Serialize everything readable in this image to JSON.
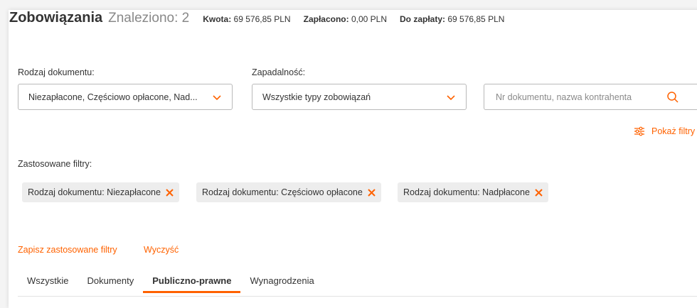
{
  "header": {
    "title": "Zobowiązania",
    "found": "Znaleziono: 2",
    "amount_label": "Kwota:",
    "amount_value": " 69 576,85 PLN",
    "paid_label": "Zapłacono:",
    "paid_value": " 0,00 PLN",
    "due_label": "Do zapłaty:",
    "due_value": " 69 576,85 PLN"
  },
  "filters": {
    "document_type_label": "Rodzaj dokumentu:",
    "document_type_value": "Niezapłacone, Częściowo opłacone, Nad...",
    "maturity_label": "Zapadalność:",
    "maturity_value": "Wszystkie typy zobowiązań",
    "search_placeholder": "Nr dokumentu, nazwa kontrahenta",
    "show_filters": "Pokaż filtry"
  },
  "applied": {
    "label": "Zastosowane filtry:",
    "chips": [
      "Rodzaj dokumentu: Niezapłacone",
      "Rodzaj dokumentu: Częściowo opłacone",
      "Rodzaj dokumentu: Nadpłacone"
    ]
  },
  "actions": {
    "save": "Zapisz zastosowane filtry",
    "clear": "Wyczyść"
  },
  "tabs": [
    {
      "label": "Wszystkie",
      "active": false
    },
    {
      "label": "Dokumenty",
      "active": false
    },
    {
      "label": "Publiczno-prawne",
      "active": true
    },
    {
      "label": "Wynagrodzenia",
      "active": false
    }
  ],
  "colors": {
    "accent": "#ff6200",
    "chip_bg": "#ededed"
  }
}
